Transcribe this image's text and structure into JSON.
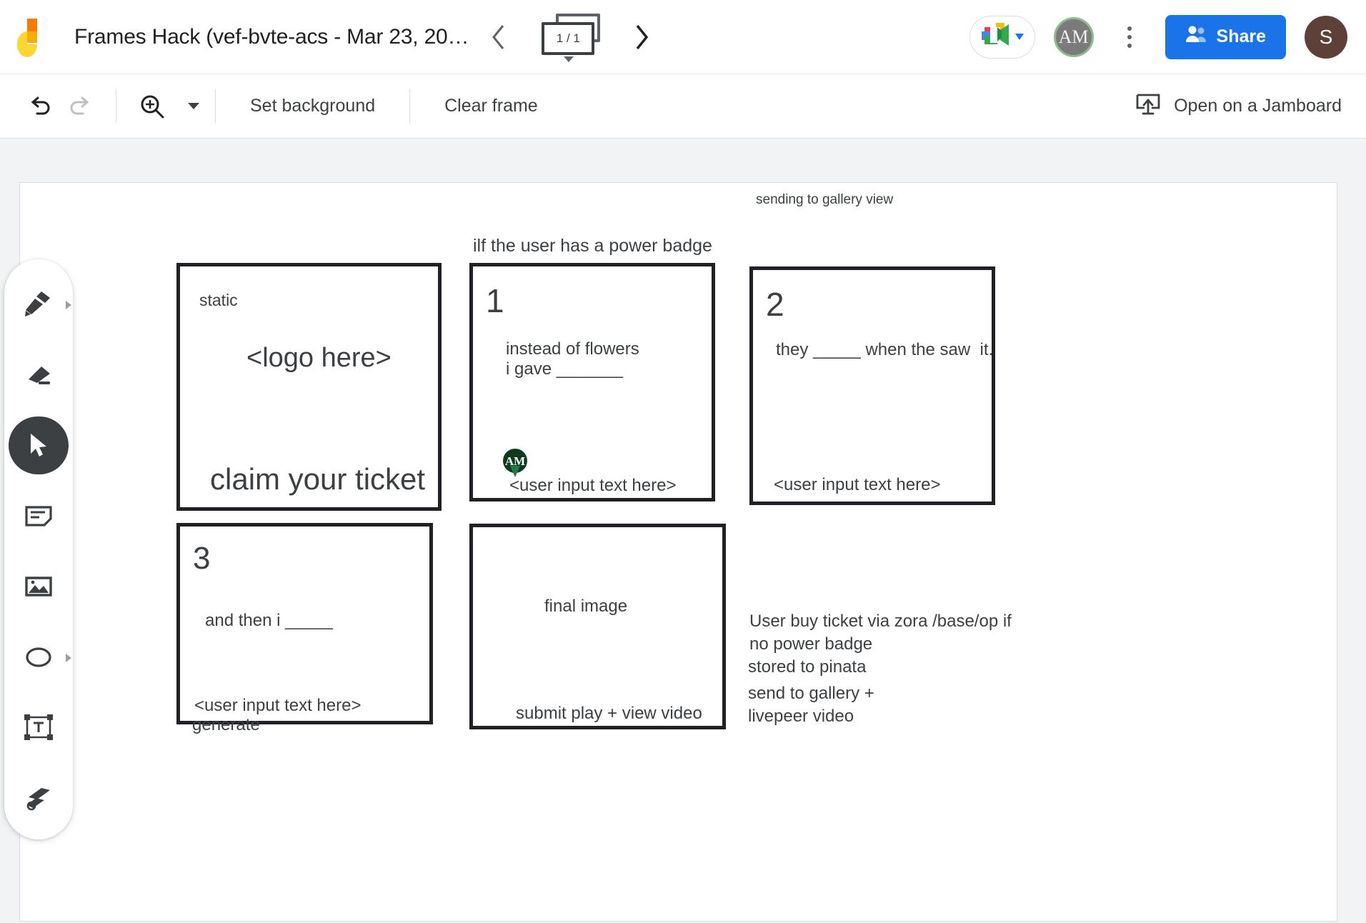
{
  "header": {
    "logo_icon": "jamboard-logo-icon",
    "doc_title": "Frames Hack (vef-bvte-acs - Mar 23, 20…",
    "prev_icon": "chevron-left-icon",
    "next_icon": "chevron-right-icon",
    "frame_counter": "1 / 1",
    "meet_icon": "google-meet-icon",
    "collaborator_initials": "AM",
    "more_icon": "kebab-menu-icon",
    "share_label": "Share",
    "share_icon": "person-add-icon",
    "share_color": "#1a73e8",
    "account_initial": "S",
    "account_color": "#5d4037"
  },
  "toolbar": {
    "undo_icon": "undo-icon",
    "redo_icon": "redo-icon",
    "zoom_icon": "zoom-in-icon",
    "zoom_caret_icon": "chevron-down-icon",
    "set_background_label": "Set background",
    "clear_frame_label": "Clear frame",
    "open_jamboard_label": "Open on a Jamboard",
    "open_jamboard_icon": "cast-upload-icon"
  },
  "toolrail": {
    "items": [
      {
        "name": "pen-tool",
        "icon": "pen-icon",
        "active": false,
        "has_submenu": true
      },
      {
        "name": "eraser-tool",
        "icon": "eraser-icon",
        "active": false,
        "has_submenu": false
      },
      {
        "name": "select-tool",
        "icon": "cursor-arrow-icon",
        "active": true,
        "has_submenu": false
      },
      {
        "name": "sticky-note-tool",
        "icon": "sticky-note-icon",
        "active": false,
        "has_submenu": false
      },
      {
        "name": "image-tool",
        "icon": "image-icon",
        "active": false,
        "has_submenu": false
      },
      {
        "name": "shape-tool",
        "icon": "circle-shape-icon",
        "active": false,
        "has_submenu": true
      },
      {
        "name": "text-box-tool",
        "icon": "text-box-icon",
        "active": false,
        "has_submenu": false
      },
      {
        "name": "laser-tool",
        "icon": "laser-pointer-icon",
        "active": false,
        "has_submenu": false
      }
    ]
  },
  "canvas": {
    "note_gallery": "sending to gallery view",
    "note_power_badge": "ilf the user has a power badge",
    "frame_static": {
      "label": "static",
      "logo_placeholder": "<logo here>",
      "cta": "claim your ticket"
    },
    "frame_one": {
      "number": "1",
      "line1": "instead of flowers",
      "line2": "i gave _______",
      "pin_initials": "AM",
      "input_placeholder": "<user input text here>"
    },
    "frame_two": {
      "number": "2",
      "line1": "they _____ when the saw  it.",
      "input_placeholder": "<user input text here>"
    },
    "frame_three": {
      "number": "3",
      "line1": "and then i _____",
      "input_placeholder": "<user input text here>",
      "action": "generate"
    },
    "frame_final": {
      "title": "final image",
      "action": "submit play + view video"
    },
    "notes_right": [
      "User buy ticket via zora /base/op if\nno power badge",
      "stored to pinata",
      "send to gallery +\nlivepeer video"
    ]
  }
}
